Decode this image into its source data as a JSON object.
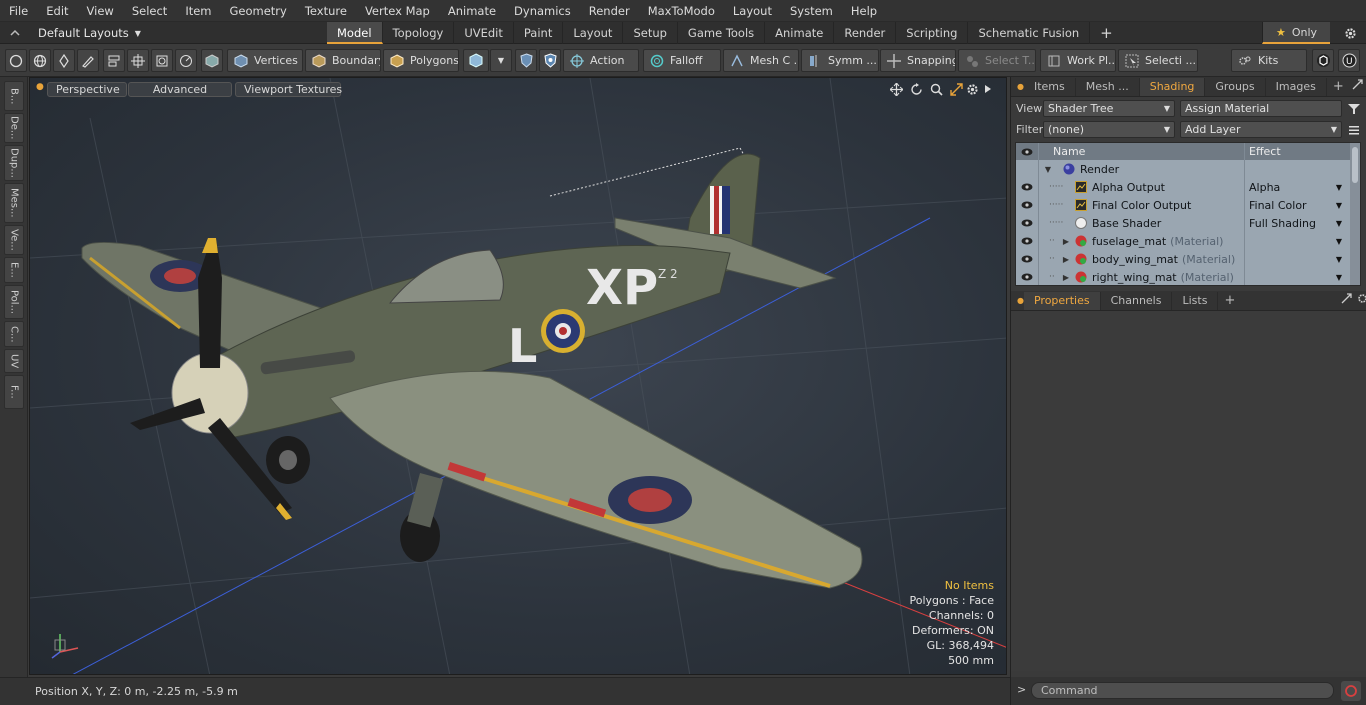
{
  "menubar": {
    "items": [
      "File",
      "Edit",
      "View",
      "Select",
      "Item",
      "Geometry",
      "Texture",
      "Vertex Map",
      "Animate",
      "Dynamics",
      "Render",
      "MaxToModo",
      "Layout",
      "System",
      "Help"
    ]
  },
  "tabbar": {
    "layout_label": "Default Layouts",
    "tabs": [
      "Model",
      "Topology",
      "UVEdit",
      "Paint",
      "Layout",
      "Setup",
      "Game Tools",
      "Animate",
      "Render",
      "Scripting",
      "Schematic Fusion"
    ],
    "active_tab": "Model",
    "add_label": "+",
    "only_label": "Only"
  },
  "toolbar": {
    "vertices": "Vertices",
    "boundary": "Boundary",
    "polygons": "Polygons",
    "action": "Action",
    "falloff": "Falloff",
    "mesh": "Mesh C ...",
    "symm": "Symm ...",
    "snapping": "Snapping",
    "select_t": "Select T...",
    "work_pl": "Work Pl...",
    "selecti": "Selecti ...",
    "kits": "Kits"
  },
  "left_tabs": [
    "B...",
    "De...",
    "Dup...",
    "Mes...",
    "Ve...",
    "E...",
    "Pol...",
    "C...",
    "UV",
    "F..."
  ],
  "viewport": {
    "view_mode": "Perspective",
    "advanced": "Advanced",
    "textures": "Viewport Textures",
    "stats": {
      "items": "No Items",
      "polygons": "Polygons : Face",
      "channels": "Channels: 0",
      "deformers": "Deformers: ON",
      "gl": "GL: 368,494",
      "scale": "500 mm"
    },
    "aircraft_code": "XP",
    "aircraft_letter": "L",
    "aircraft_serial": "Z 2"
  },
  "status": {
    "position": "Position X, Y, Z:   0 m, -2.25 m, -5.9 m"
  },
  "right_panel": {
    "top_tabs": [
      "Items",
      "Mesh ...",
      "Shading",
      "Groups",
      "Images"
    ],
    "active_top_tab": "Shading",
    "view_label": "View",
    "view_value": "Shader Tree",
    "assign_material": "Assign Material",
    "filter_label": "Filter",
    "filter_value": "(none)",
    "add_layer": "Add Layer",
    "tree": {
      "col_name": "Name",
      "col_effect": "Effect",
      "rows": [
        {
          "name": "Render",
          "suffix": "",
          "effect": ""
        },
        {
          "name": "Alpha Output",
          "suffix": "",
          "effect": "Alpha"
        },
        {
          "name": "Final Color Output",
          "suffix": "",
          "effect": "Final Color"
        },
        {
          "name": "Base Shader",
          "suffix": "",
          "effect": "Full Shading"
        },
        {
          "name": "fuselage_mat",
          "suffix": "(Material)",
          "effect": ""
        },
        {
          "name": "body_wing_mat",
          "suffix": "(Material)",
          "effect": ""
        },
        {
          "name": "right_wing_mat",
          "suffix": "(Material)",
          "effect": ""
        }
      ]
    },
    "bottom_tabs": [
      "Properties",
      "Channels",
      "Lists"
    ],
    "active_bottom_tab": "Properties",
    "command_placeholder": "Command",
    "command_prompt": ">"
  },
  "colors": {
    "accent": "#e8a33a",
    "shading_tab": "#f0a840",
    "stats_warn": "#f0c040"
  }
}
